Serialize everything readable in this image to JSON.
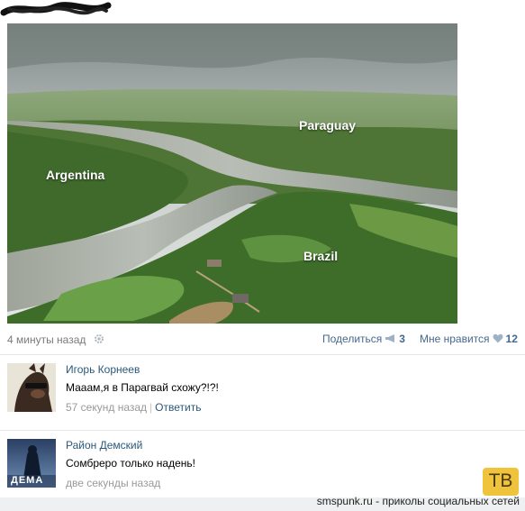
{
  "post": {
    "photo_labels": {
      "paraguay": "Paraguay",
      "argentina": "Argentina",
      "brazil": "Brazil"
    },
    "time": "4 минуты назад",
    "share_label": "Поделиться",
    "share_count": "3",
    "like_label": "Мне нравится",
    "like_count": "12"
  },
  "comments": [
    {
      "author": "Игорь Корнеев",
      "text": "Мааам,я в Парагвай схожу?!?!",
      "time": "57 секунд назад",
      "reply_label": "Ответить"
    },
    {
      "author": "Район Демский",
      "text": "Сомбреро только надень!",
      "time": "две секунды назад",
      "avatar_caption": "ДЕМА"
    }
  ],
  "watermark": {
    "text": "smspunk.ru - приколы социальных сетей",
    "logo": "ТВ"
  },
  "colors": {
    "link": "#2b587a",
    "action": "#45688e",
    "meta": "#999999",
    "logo_bg": "#f0c33c"
  }
}
